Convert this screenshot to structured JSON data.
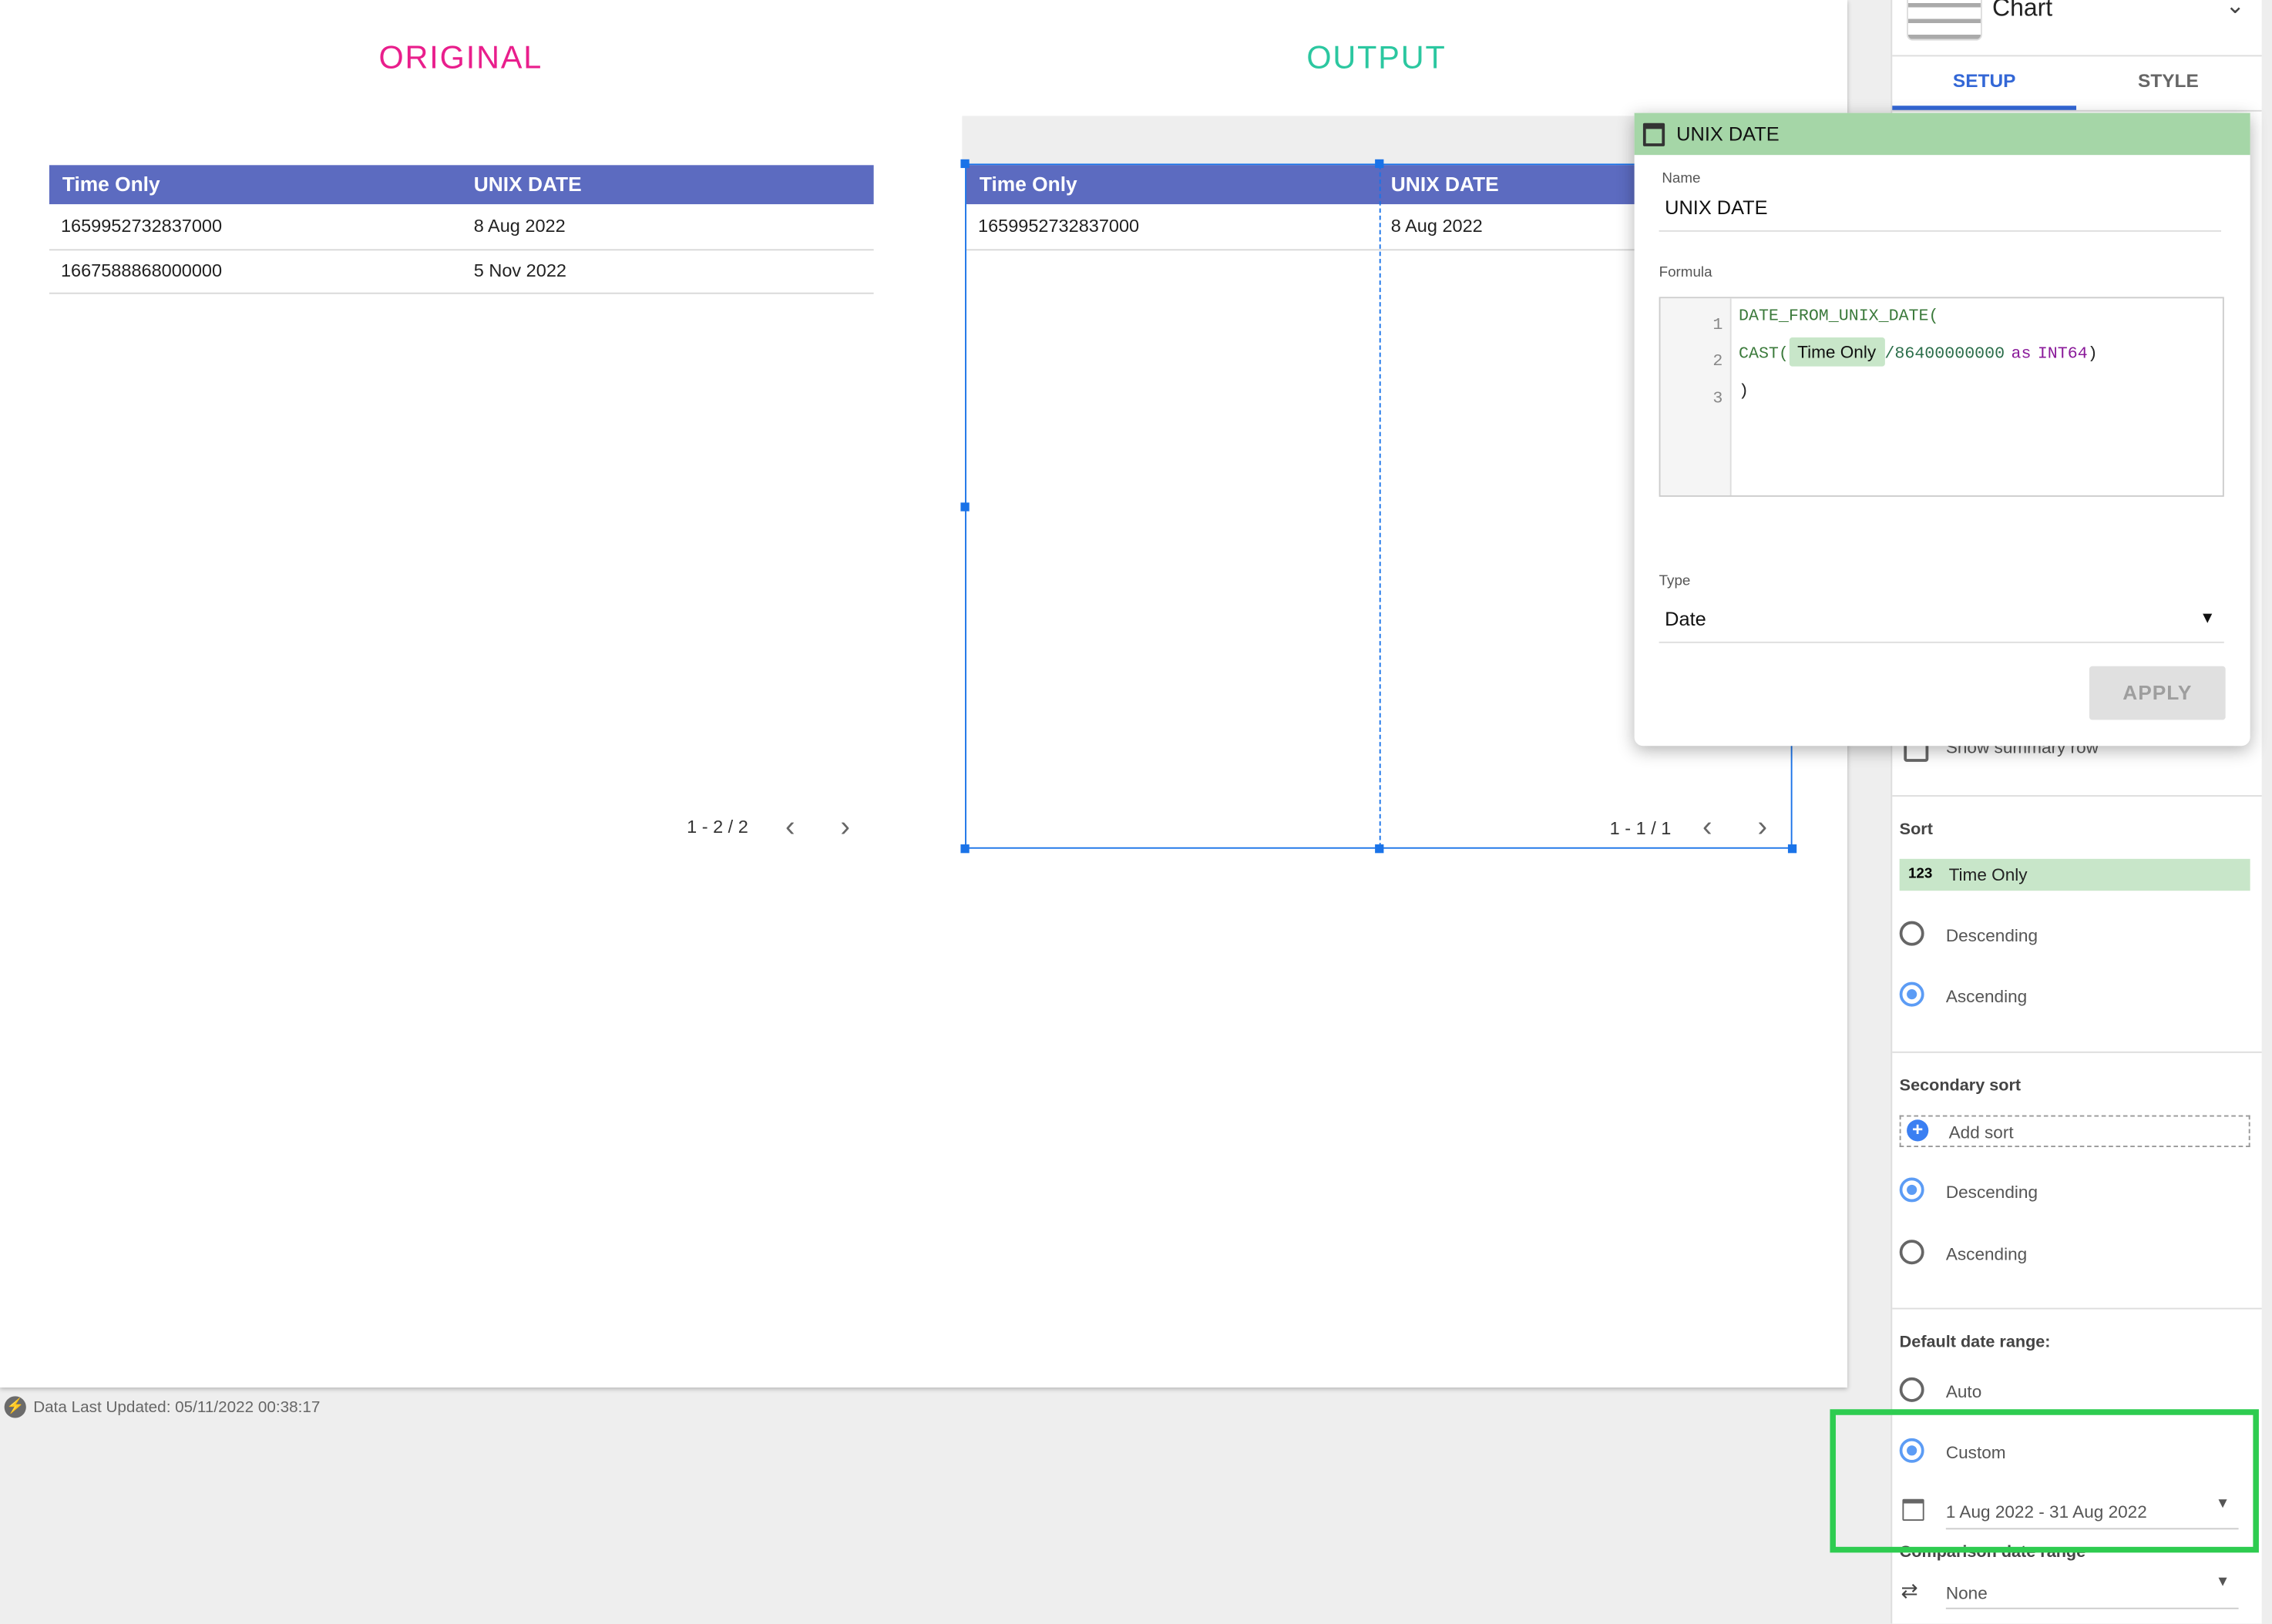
{
  "canvas": {
    "original_title": "ORIGINAL",
    "output_title": "OUTPUT",
    "colors": {
      "original_title": "#e91e8c",
      "output_title": "#2bc7a0",
      "table_header": "#5c6bc0",
      "selection": "#1a73e8"
    },
    "original_table": {
      "columns": [
        "Time Only",
        "UNIX DATE"
      ],
      "rows": [
        [
          "1659952732837000",
          "8 Aug 2022"
        ],
        [
          "1667588868000000",
          "5 Nov 2022"
        ]
      ],
      "pager": "1 - 2 / 2"
    },
    "output_table": {
      "columns": [
        "Time Only",
        "UNIX DATE"
      ],
      "rows": [
        [
          "1659952732837000",
          "8 Aug 2022"
        ]
      ],
      "pager": "1 - 1 / 1"
    }
  },
  "footer": {
    "status": "Data Last Updated: 05/11/2022 00:38:17",
    "icon": "lightning-icon"
  },
  "panel": {
    "header": "Chart",
    "tabs": [
      {
        "label": "SETUP",
        "active": true
      },
      {
        "label": "STYLE",
        "active": false
      }
    ],
    "summary_row_label": "Show summary row",
    "sort": {
      "label": "Sort",
      "field_type": "123",
      "field": "Time Only",
      "options": [
        {
          "label": "Descending",
          "selected": false
        },
        {
          "label": "Ascending",
          "selected": true
        }
      ]
    },
    "secondary_sort": {
      "label": "Secondary sort",
      "add_label": "Add sort",
      "options": [
        {
          "label": "Descending",
          "selected": true
        },
        {
          "label": "Ascending",
          "selected": false
        }
      ]
    },
    "date_range": {
      "label": "Default date range:",
      "options": [
        {
          "label": "Auto",
          "selected": false
        },
        {
          "label": "Custom",
          "selected": true
        }
      ],
      "value": "1 Aug 2022 - 31 Aug 2022"
    },
    "comparison": {
      "label": "Comparison date range",
      "value": "None"
    }
  },
  "popup": {
    "title": "UNIX DATE",
    "name_label": "Name",
    "name_value": "UNIX DATE",
    "formula_label": "Formula",
    "formula": {
      "line_numbers": [
        "1",
        "2",
        "3"
      ],
      "line1": "DATE_FROM_UNIX_DATE(",
      "cast": "CAST(",
      "field_chip": "Time Only",
      "divisor": "/86400000000",
      "as_kw": "as",
      "type_kw": "INT64",
      "close_paren": ")",
      "line3": ")"
    },
    "type_label": "Type",
    "type_value": "Date",
    "apply_label": "APPLY",
    "header_color": "#a5d6a7"
  },
  "highlight_color": "#2ecc50"
}
